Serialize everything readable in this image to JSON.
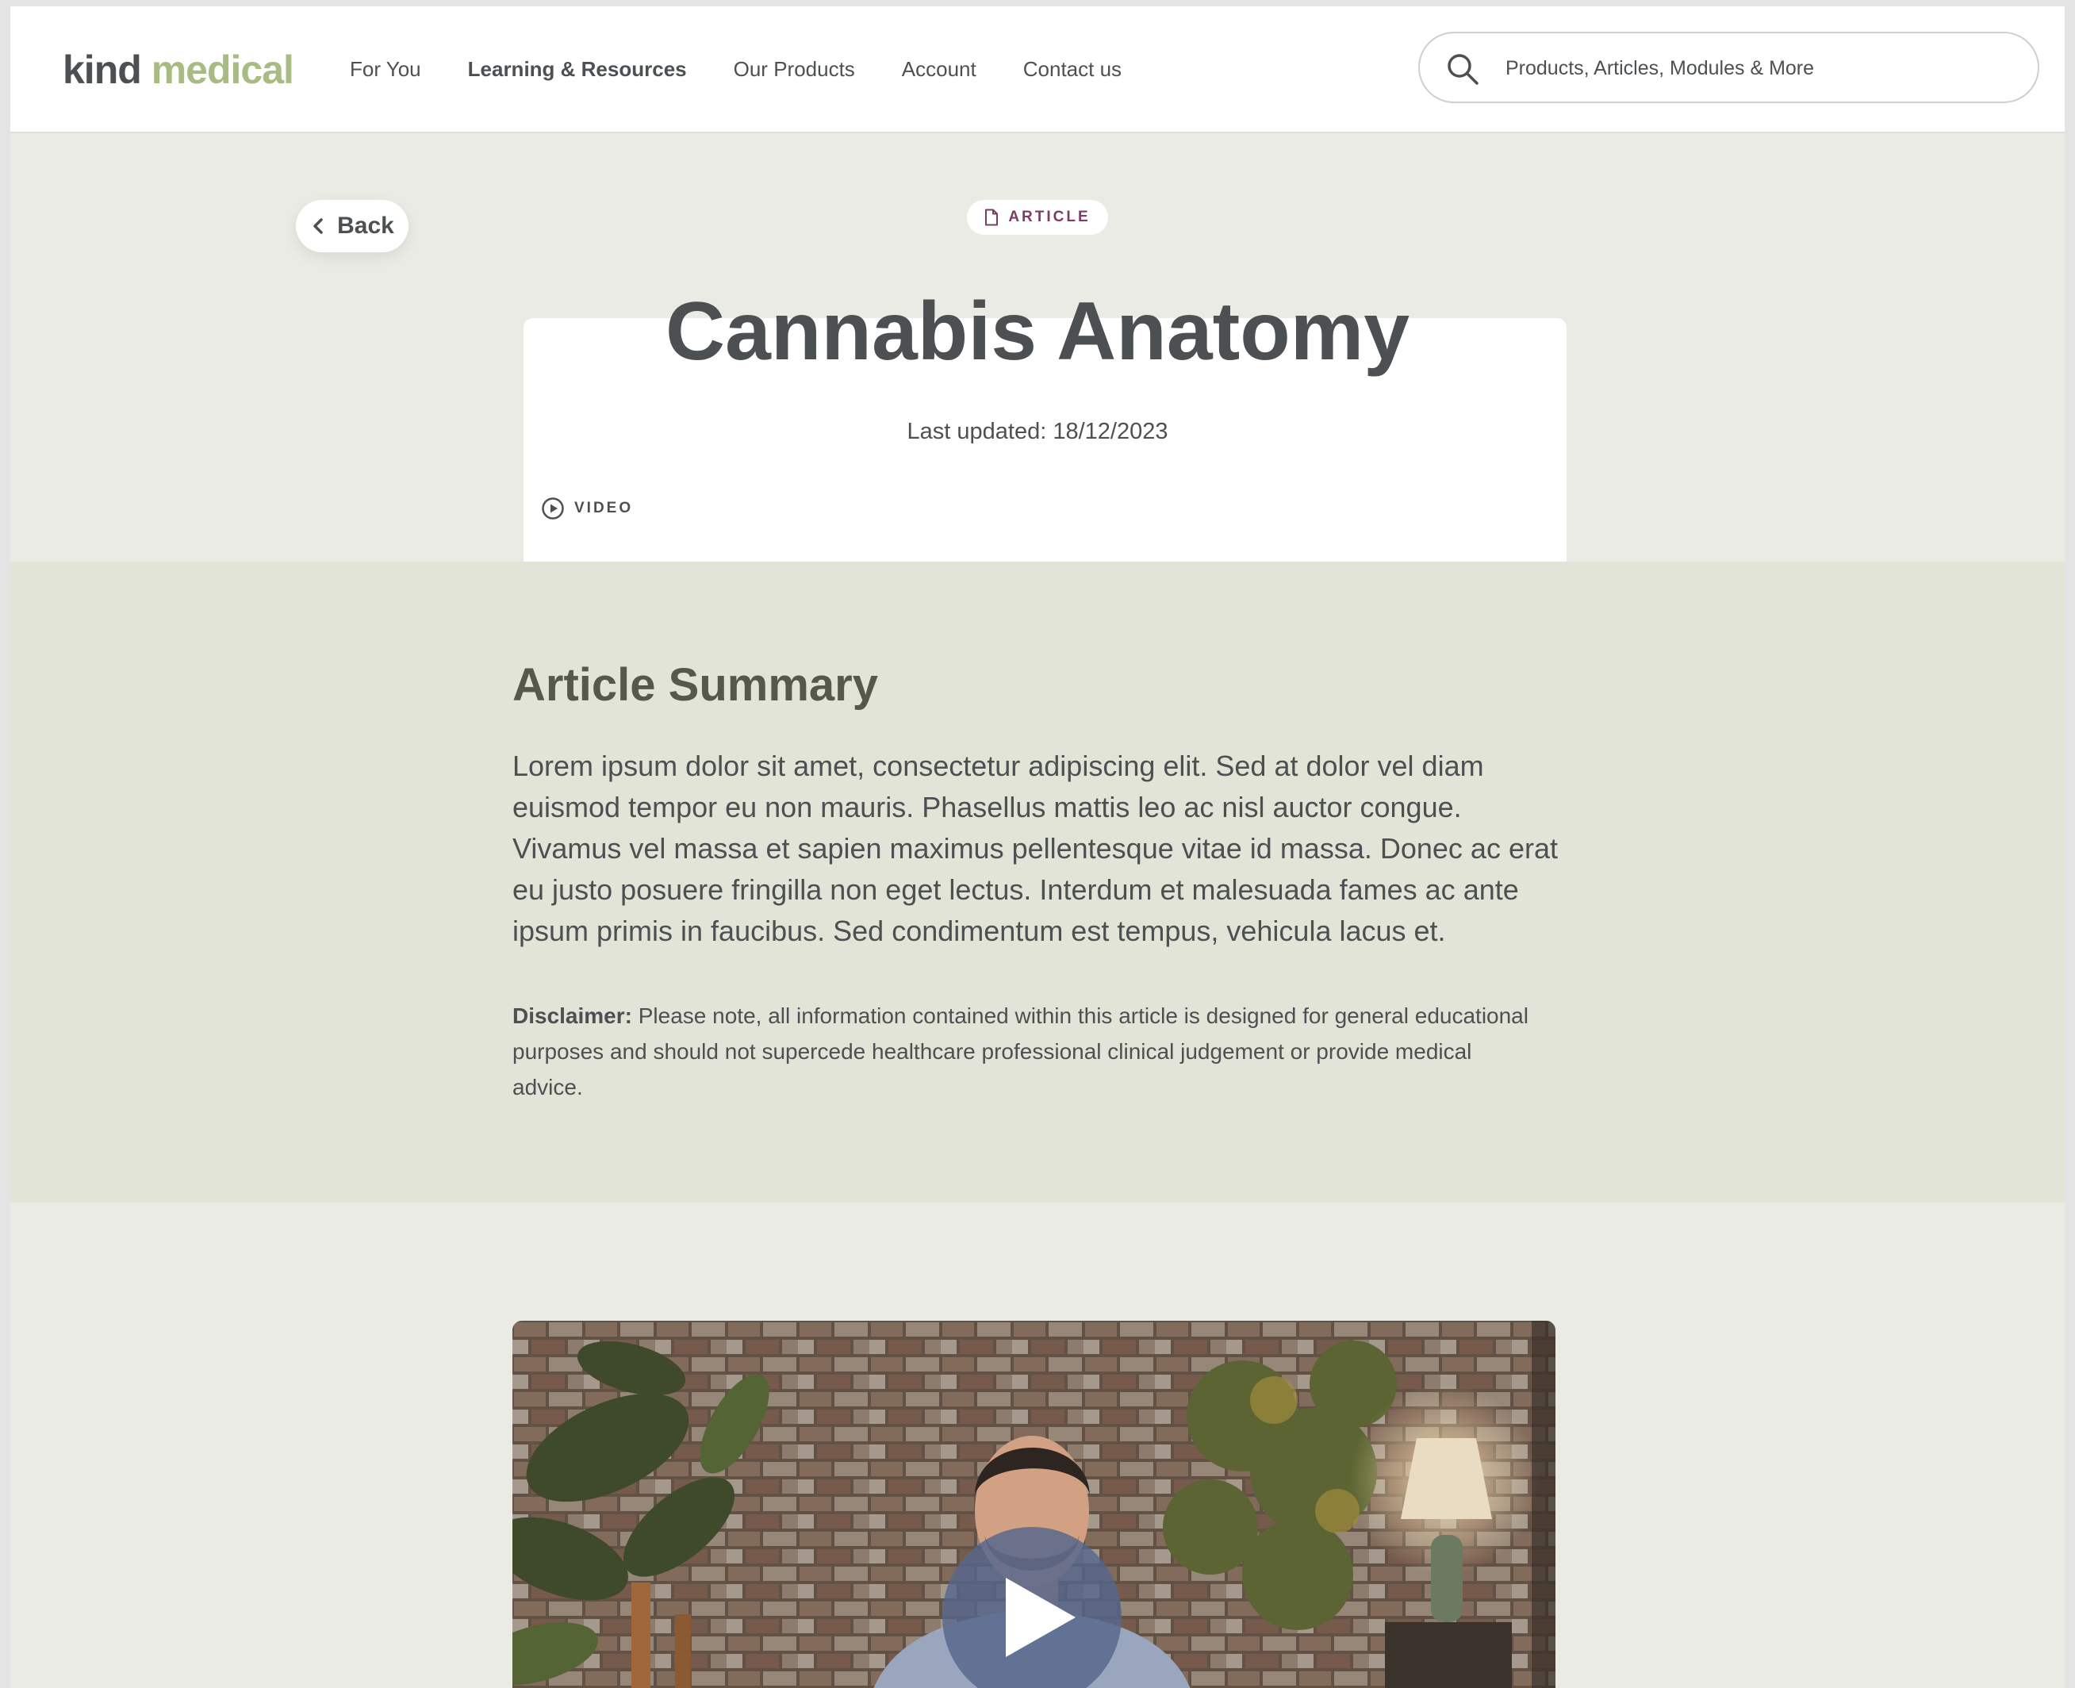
{
  "header": {
    "logo": {
      "part1": "kind",
      "part2": "medical"
    },
    "nav": [
      {
        "label": "For You",
        "active": false
      },
      {
        "label": "Learning & Resources",
        "active": true
      },
      {
        "label": "Our Products",
        "active": false
      },
      {
        "label": "Account",
        "active": false
      },
      {
        "label": "Contact us",
        "active": false
      }
    ],
    "search": {
      "placeholder": "Products, Articles, Modules & More"
    }
  },
  "hero": {
    "back_label": "Back",
    "tags": {
      "article": "ARTICLE",
      "video": "VIDEO"
    },
    "title": "Cannabis Anatomy",
    "updated_label": "Last updated:",
    "updated_date": "18/12/2023"
  },
  "summary": {
    "heading": "Article Summary",
    "body": "Lorem ipsum dolor sit amet, consectetur adipiscing elit. Sed at dolor vel diam euismod tempor eu non mauris. Phasellus mattis leo ac nisl auctor congue. Vivamus vel massa et sapien maximus pellentesque vitae id massa. Donec ac erat eu justo posuere fringilla non eget lectus. Interdum et malesuada fames ac ante ipsum primis in faucibus. Sed condimentum est tempus, vehicula lacus et.",
    "disclaimer_label": "Disclaimer:",
    "disclaimer_text": " Please note, all information contained within this article is designed for general educational purposes and should not supercede healthcare professional clinical judgement or provide medical advice."
  },
  "colors": {
    "brand_dark": "#4d5052",
    "brand_green": "#a8bb83",
    "hero_bg": "#e9ebe4",
    "summary_bg": "#e1e4d6",
    "article_tag": "#7a3d63",
    "play_button": "#56678c"
  },
  "icons": {
    "search": "search-icon",
    "back": "chevron-left-icon",
    "article": "document-icon",
    "video": "play-circle-icon",
    "play": "play-icon"
  }
}
